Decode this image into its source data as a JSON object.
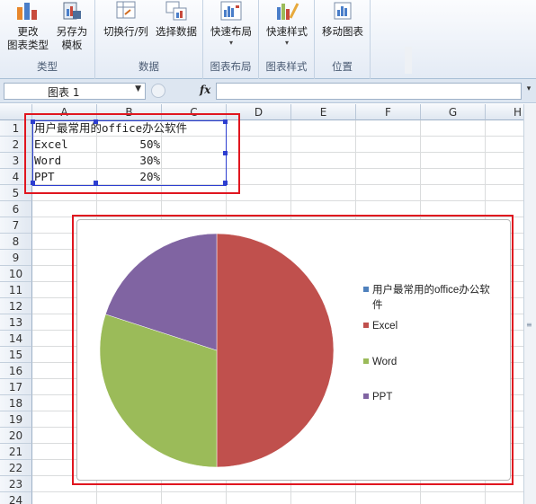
{
  "ribbon": {
    "groups": [
      {
        "label": "类型",
        "buttons": [
          {
            "label": "更改\n图表类型"
          },
          {
            "label": "另存为\n模板"
          }
        ]
      },
      {
        "label": "数据",
        "buttons": [
          {
            "label": "切换行/列"
          },
          {
            "label": "选择数据"
          }
        ]
      },
      {
        "label": "图表布局",
        "buttons": [
          {
            "label": "快速布局"
          }
        ]
      },
      {
        "label": "图表样式",
        "buttons": [
          {
            "label": "快速样式"
          }
        ]
      },
      {
        "label": "位置",
        "buttons": [
          {
            "label": "移动图表"
          }
        ]
      }
    ]
  },
  "formula_bar": {
    "name_box": "图表 1",
    "fx": "fx",
    "formula": ""
  },
  "grid": {
    "columns": [
      "A",
      "B",
      "C",
      "D",
      "E",
      "F",
      "G",
      "H"
    ],
    "rows": [
      "1",
      "2",
      "3",
      "4",
      "5",
      "6",
      "7",
      "8",
      "9",
      "10",
      "11",
      "12",
      "13",
      "14",
      "15",
      "16",
      "17",
      "18",
      "19",
      "20",
      "21",
      "22",
      "23",
      "24"
    ],
    "cells": {
      "A1": "用户最常用的office办公软件",
      "A2": "Excel",
      "B2": "50%",
      "A3": "Word",
      "B3": "30%",
      "A4": "PPT",
      "B4": "20%"
    }
  },
  "chart_data": {
    "type": "pie",
    "title": "",
    "categories": [
      "Excel",
      "Word",
      "PPT"
    ],
    "values": [
      50,
      30,
      20
    ],
    "series": [
      {
        "name": "用户最常用的office办公软件",
        "values": [
          50,
          30,
          20
        ]
      }
    ],
    "colors": [
      "#C0504D",
      "#9BBB59",
      "#8064A2"
    ],
    "series_color": "#4F81BD",
    "legend": {
      "position": "right",
      "entries": [
        "用户最常用的office办公软件",
        "Excel",
        "Word",
        "PPT"
      ]
    }
  },
  "highlight_color": "#E0161F"
}
